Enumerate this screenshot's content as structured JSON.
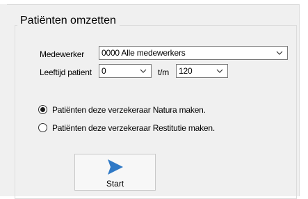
{
  "group": {
    "title": "Patiënten omzetten"
  },
  "form": {
    "employee_label": "Medewerker",
    "employee_value": "0000 Alle medewerkers",
    "age_label": "Leeftijd patient",
    "age_from_value": "0",
    "age_to_separator": "t/m",
    "age_to_value": "120"
  },
  "options": {
    "natura_label": "Patiënten deze verzekeraar Natura maken.",
    "natura_selected": true,
    "restitutie_label": "Patiënten deze verzekeraar Restitutie maken.",
    "restitutie_selected": false
  },
  "actions": {
    "start_label": "Start",
    "start_icon": "play-icon"
  },
  "colors": {
    "accent": "#2f79c6",
    "window_bg": "#f0f0f0",
    "border": "#7a7a7a"
  }
}
